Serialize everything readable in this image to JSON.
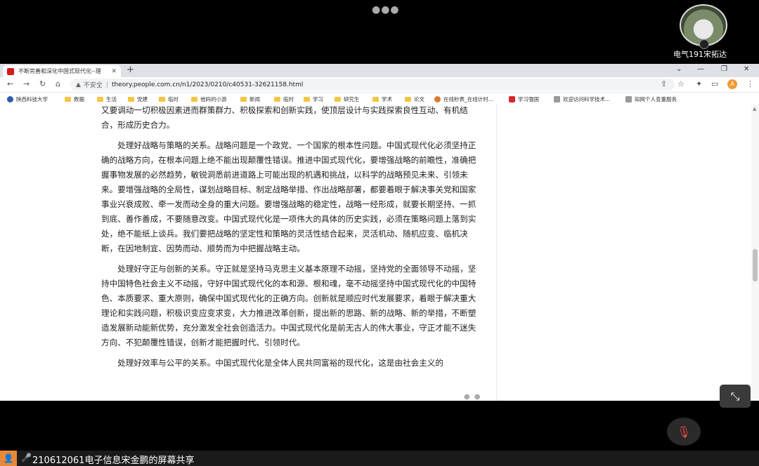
{
  "meeting": {
    "participant_name": "电气191宋拓达",
    "share_label": "210612061电子信息宋金鹏的屏幕共享"
  },
  "browser": {
    "tab_title": "不断完善和深化中国式现代化--理",
    "insecure_label": "不安全",
    "url": "theory.people.com.cn/n1/2023/0210/c40531-32621158.html",
    "profile_initial": "A",
    "bookmarks": [
      {
        "label": "陕西科技大学",
        "icon": "school-icon"
      },
      {
        "label": "数据",
        "icon": "folder-icon"
      },
      {
        "label": "生活",
        "icon": "folder-icon"
      },
      {
        "label": "党建",
        "icon": "folder-icon"
      },
      {
        "label": "临时",
        "icon": "folder-icon"
      },
      {
        "label": "他妈的小游",
        "icon": "folder-icon"
      },
      {
        "label": "新闻",
        "icon": "folder-icon"
      },
      {
        "label": "临时",
        "icon": "folder-icon"
      },
      {
        "label": "学习",
        "icon": "folder-icon"
      },
      {
        "label": "研究生",
        "icon": "folder-icon"
      },
      {
        "label": "学术",
        "icon": "folder-icon"
      },
      {
        "label": "论文",
        "icon": "folder-icon"
      },
      {
        "label": "在线秒表_在线计时...",
        "icon": "timer-icon"
      },
      {
        "label": "学习强国",
        "icon": "xuexi-icon"
      },
      {
        "label": "欢迎访问科学技术...",
        "icon": "page-icon"
      },
      {
        "label": "知网个人查重服务",
        "icon": "page-icon"
      }
    ]
  },
  "article": {
    "paragraphs": [
      {
        "cont": true,
        "text": "又要调动一切积极因素进而群策群力、积极探索和创新实践，使顶层设计与实践探索良性互动、有机结合，形成历史合力。"
      },
      {
        "cont": false,
        "text": "处理好战略与策略的关系。战略问题是一个政党、一个国家的根本性问题。中国式现代化必须坚持正确的战略方向，在根本问题上绝不能出现颠覆性错误。推进中国式现代化，要增强战略的前瞻性，准确把握事物发展的必然趋势，敏锐洞悉前进道路上可能出现的机遇和挑战，以科学的战略预见未来、引领未来。要增强战略的全局性，谋划战略目标、制定战略举措、作出战略部署，都要着眼于解决事关党和国家事业兴衰成败、牵一发而动全身的重大问题。要增强战略的稳定性，战略一经形成，就要长期坚持、一抓到底、善作善成，不要随意改变。中国式现代化是一项伟大的具体的历史实践，必须在策略问题上落到实处，绝不能纸上谈兵。我们要把战略的坚定性和策略的灵活性结合起来，灵活机动、随机应变、临机决断，在因地制宜、因势而动、顺势而为中把握战略主动。"
      },
      {
        "cont": false,
        "text": "处理好守正与创新的关系。守正就是坚持马克思主义基本原理不动摇，坚持党的全面领导不动摇，坚持中国特色社会主义不动摇，守好中国式现代化的本和源、根和魂，毫不动摇坚持中国式现代化的中国特色、本质要求、重大原则，确保中国式现代化的正确方向。创新就是顺应时代发展要求，着眼于解决重大理论和实践问题，积极识变应变求变，大力推进改革创新，提出新的思路、新的战略、新的举措，不断塑造发展新动能新优势，充分激发全社会创造活力。中国式现代化是前无古人的伟大事业，守正才能不迷失方向、不犯颠覆性错误，创新才能把握时代、引领时代。"
      },
      {
        "cont": false,
        "text": "处理好效率与公平的关系。中国式现代化是全体人民共同富裕的现代化，这是由社会主义的"
      }
    ]
  }
}
